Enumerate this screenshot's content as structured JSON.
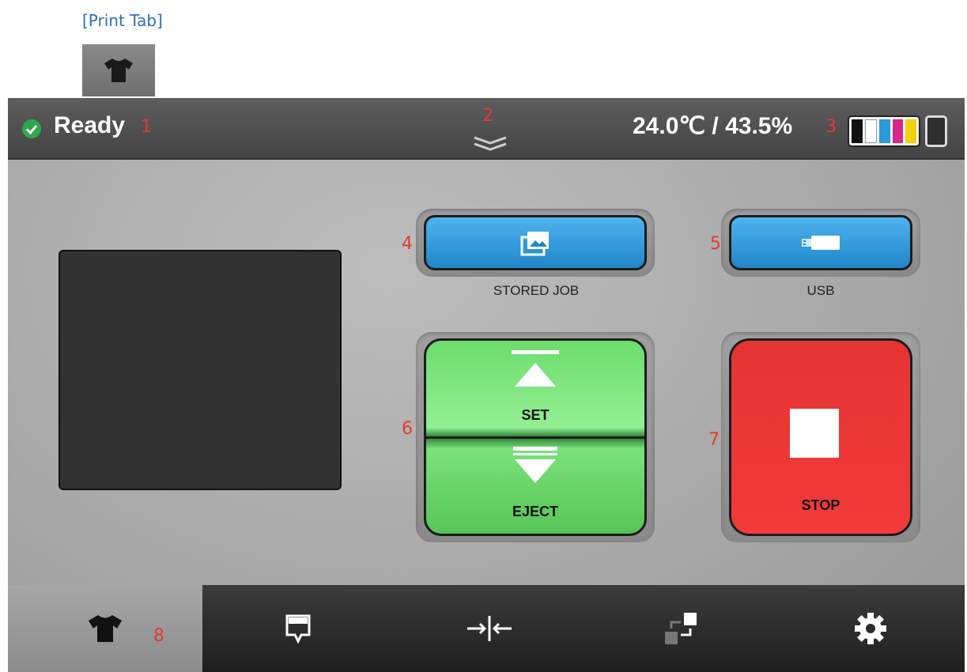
{
  "caption": "[Print Tab]",
  "status": {
    "text": "Ready",
    "callout": "1"
  },
  "header": {
    "chevron_callout": "2",
    "env_readout": "24.0℃ / 43.5%",
    "gauge_callout": "3",
    "ink_colors": [
      "#111111",
      "#ffffff",
      "#2a9ad8",
      "#d9268a",
      "#f2d20a"
    ]
  },
  "buttons": {
    "stored_job": {
      "label": "STORED JOB",
      "callout": "4",
      "icon": "gallery-icon"
    },
    "usb": {
      "label": "USB",
      "callout": "5",
      "icon": "usb-drive-icon"
    },
    "set": {
      "label": "SET"
    },
    "eject": {
      "label": "EJECT"
    },
    "set_eject_callout": "6",
    "stop": {
      "label": "STOP",
      "callout": "7"
    }
  },
  "nav": {
    "callout": "8",
    "tabs": [
      {
        "name": "print",
        "icon": "tshirt-icon",
        "active": true
      },
      {
        "name": "ink",
        "icon": "ink-pod-icon",
        "active": false
      },
      {
        "name": "align",
        "icon": "align-icon",
        "active": false
      },
      {
        "name": "transfer",
        "icon": "transfer-icon",
        "active": false
      },
      {
        "name": "settings",
        "icon": "gear-icon",
        "active": false
      }
    ]
  },
  "colors": {
    "accent_blue": "#2e6fb8",
    "ready_green": "#2ea84a",
    "callout_red": "#e53935",
    "stop_red": "#f43a3a",
    "set_green": "#6cdc6c"
  }
}
